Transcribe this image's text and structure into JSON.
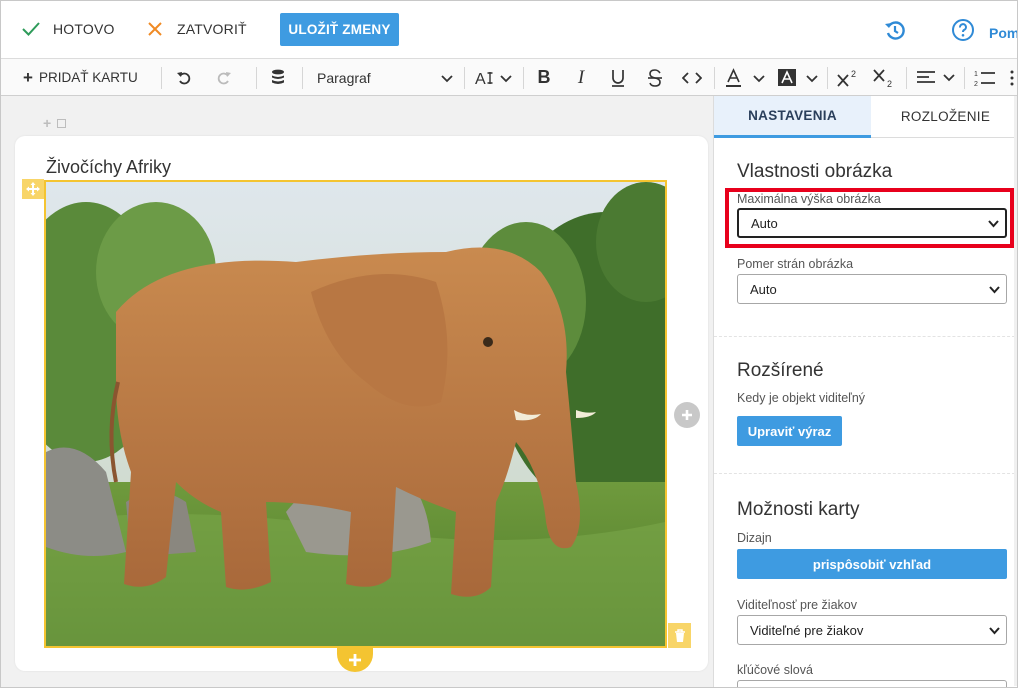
{
  "topbar": {
    "done_label": "HOTOVO",
    "close_label": "ZATVORIŤ",
    "save_label": "ULOŽIŤ ZMENY",
    "help_label": "Pom"
  },
  "toolbar": {
    "add_card_label": "PRIDAŤ KARTU",
    "paragraph_value": "Paragraf"
  },
  "editor": {
    "card_title": "Živočíchy Afriky"
  },
  "panel": {
    "tabs": [
      "NASTAVENIA",
      "ROZLOŽENIE"
    ],
    "image_props": {
      "title": "Vlastnosti obrázka",
      "max_height_label": "Maximálna výška obrázka",
      "max_height_value": "Auto",
      "aspect_label": "Pomer strán obrázka",
      "aspect_value": "Auto"
    },
    "advanced": {
      "title": "Rozšírené",
      "visibility_label": "Kedy je objekt viditeľný",
      "edit_button": "Upraviť výraz"
    },
    "card_options": {
      "title": "Možnosti karty",
      "design_label": "Dizajn",
      "design_button": "prispôsobiť vzhľad",
      "students_label": "Viditeľnosť pre žiakov",
      "students_value": "Viditeľné pre žiakov",
      "keywords_label": "kľúčové slová"
    }
  },
  "colors": {
    "accent": "#3e9be1",
    "highlight": "#e8001c",
    "image_border": "#f4c431",
    "done_check": "#2e9b5a",
    "close_x": "#f08a24"
  }
}
